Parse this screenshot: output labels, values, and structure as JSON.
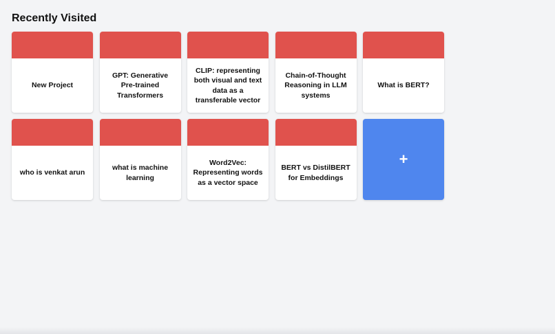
{
  "section": {
    "title": "Recently Visited"
  },
  "colors": {
    "background": "#f3f4f6",
    "card_header": "#e0524d",
    "card_body": "#ffffff",
    "add_card": "#4f86ee"
  },
  "cards": [
    {
      "title": "New Project"
    },
    {
      "title": "GPT: Generative Pre-trained Transformers"
    },
    {
      "title": "CLIP: representing both visual and text data as a transferable vector"
    },
    {
      "title": "Chain-of-Thought Reasoning in LLM systems"
    },
    {
      "title": "What is BERT?"
    },
    {
      "title": "who is venkat arun"
    },
    {
      "title": "what is machine learning"
    },
    {
      "title": "Word2Vec: Representing words as a vector space"
    },
    {
      "title": "BERT vs DistilBERT for Embeddings"
    }
  ],
  "add_card": {
    "icon": "plus-icon",
    "symbol": "+"
  }
}
